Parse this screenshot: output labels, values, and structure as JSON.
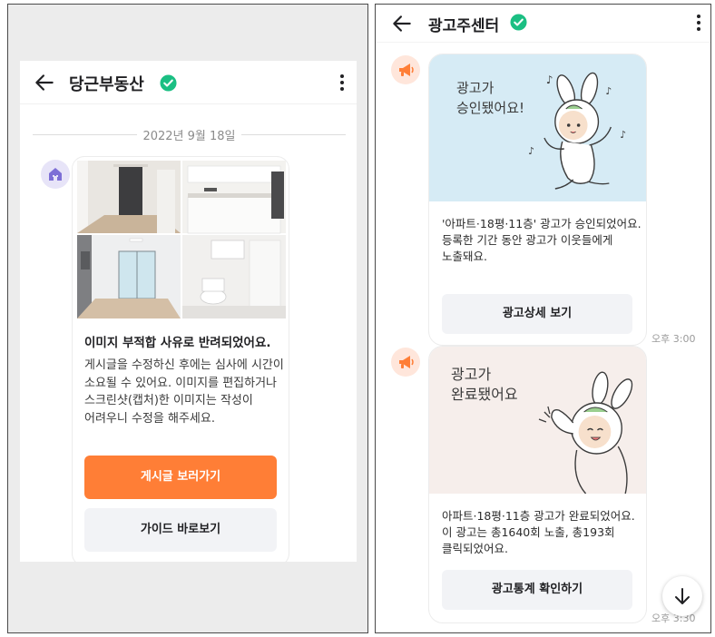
{
  "left": {
    "header": {
      "title": "당근부동산"
    },
    "date_divider": "2022년 9월 18일",
    "message": {
      "title": "이미지 부적합 사유로 반려되었어요.",
      "body": "게시글을 수정하신 후에는 심사에 시간이 소요될 수 있어요. 이미지를 편집하거나 스크린샷(캡처)한 이미지는 작성이 어려우니 수정을 해주세요.",
      "primary_button": "게시글 보러가기",
      "secondary_button": "가이드 바로보기"
    }
  },
  "right": {
    "header": {
      "title": "광고주센터"
    },
    "messages": [
      {
        "illustration_text": [
          "광고가",
          "승인됐어요!"
        ],
        "body": "'아파트·18평·11층' 광고가 승인되었어요. 등록한 기간 동안 광고가 이웃들에게 노출돼요.",
        "button": "광고상세 보기",
        "time": "오후 3:00"
      },
      {
        "illustration_text": [
          "광고가",
          "완료됐어요"
        ],
        "body": "아파트·18평·11층 광고가 완료되었어요. 이 광고는 총1640회 노출, 총193회 클릭되었어요.",
        "button": "광고통계 확인하기",
        "time": "오후 3:30"
      }
    ]
  },
  "colors": {
    "accent_orange": "#ff7e36",
    "verified_green": "#1bbf83",
    "illustration_blue_bg": "#d6ebf5",
    "illustration_pink_bg": "#f6eeeb"
  },
  "icons": [
    "back-arrow-icon",
    "verified-badge-icon",
    "more-vertical-icon",
    "house-icon",
    "megaphone-icon",
    "arrow-down-icon"
  ]
}
